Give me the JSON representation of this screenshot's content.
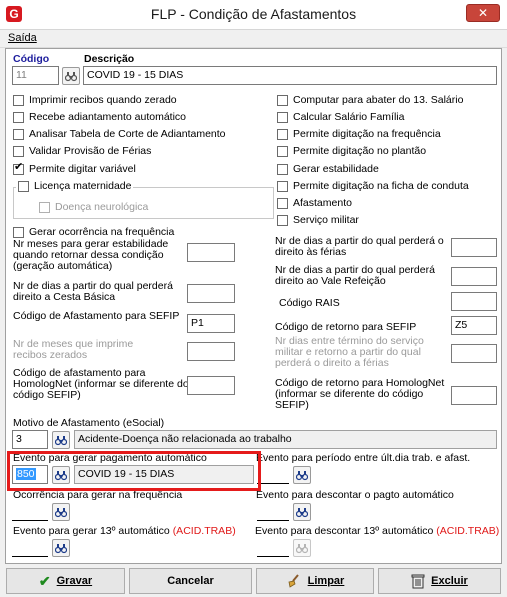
{
  "window": {
    "title": "FLP - Condição de Afastamentos",
    "close_glyph": "✕",
    "app_icon_glyph": "G"
  },
  "menu": {
    "items": [
      "Saída"
    ]
  },
  "header": {
    "codigo_label": "Código",
    "descricao_label": "Descrição",
    "codigo_value": "11",
    "descricao_value": "COVID 19 - 15 DIAS"
  },
  "left_checks": [
    {
      "label": "Imprimir recibos quando zerado",
      "checked": false
    },
    {
      "label": "Recebe adiantamento automático",
      "checked": false
    },
    {
      "label": "Analisar Tabela de Corte de Adiantamento",
      "checked": false
    },
    {
      "label": "Validar Provisão de Férias",
      "checked": false
    },
    {
      "label": "Permite digitar variável",
      "checked": true
    }
  ],
  "licenca": {
    "label": "Licença maternidade",
    "sub_label": "Doença neurológica"
  },
  "right_checks": [
    {
      "label": "Computar para abater do 13. Salário",
      "checked": false
    },
    {
      "label": "Calcular Salário Família",
      "checked": false
    },
    {
      "label": "Permite digitação na frequência",
      "checked": false
    },
    {
      "label": "Permite digitação no plantão",
      "checked": false
    },
    {
      "label": "Gerar estabilidade",
      "checked": false
    },
    {
      "label": "Permite digitação na ficha de conduta",
      "checked": false
    },
    {
      "label": "Afastamento",
      "checked": false
    },
    {
      "label": "Serviço militar",
      "checked": false
    }
  ],
  "gerar_ocorrencia": "Gerar ocorrência na frequência",
  "fields_left": {
    "nr_meses_estab": "Nr meses para gerar estabilidade quando retornar dessa condição (geração automática)",
    "nr_dias_cesta": "Nr de dias a partir do qual perderá direito a Cesta Básica",
    "cod_afast_sefip": "Código de Afastamento para SEFIP",
    "cod_afast_sefip_value": "P1",
    "nr_meses_recibos": "Nr de meses que imprime recibos zerados",
    "cod_homolognet": "Código de afastamento para HomologNet (informar se diferente do código SEFIP)"
  },
  "fields_right": {
    "nr_dias_ferias": "Nr de dias a partir do qual perderá o direito às férias",
    "nr_dias_vale": "Nr de dias a partir do qual perderá direito ao Vale Refeição",
    "codigo_rais": "Código RAIS",
    "cod_retorno_sefip": "Código de retorno para SEFIP",
    "cod_retorno_sefip_value": "Z5",
    "nr_dias_termino": "Nr dias entre término do serviço militar e retorno a partir do qual perderá o direito a férias",
    "cod_retorno_homolognet": "Código de retorno para HomologNet (informar se diferente do código SEFIP)"
  },
  "motivo": {
    "label": "Motivo de Afastamento (eSocial)",
    "code": "3",
    "desc": "Acidente-Doença não relacionada ao trabalho"
  },
  "eventos": {
    "pagamento_label": "Evento para gerar pagamento automático",
    "pagamento_code": "850",
    "pagamento_desc": "COVID 19 - 15 DIAS",
    "periodo_label": "Evento para período entre últ.dia trab. e afast.",
    "ocorrencia_label": "Ocorrência para gerar na frequência",
    "descontar_label": "Evento para descontar o pagto automático",
    "gerar13_label": "Evento para gerar 13º automático",
    "gerar13_tag": "(ACID.TRAB)",
    "descontar13_label": "Evento para descontar 13º automático",
    "descontar13_tag": "(ACID.TRAB)"
  },
  "buttons": {
    "gravar": "Gravar",
    "cancelar": "Cancelar",
    "limpar": "Limpar",
    "excluir": "Excluir"
  },
  "colors": {
    "highlight": "#e51b1b",
    "accent_blue": "#1c1c9c",
    "tag_red": "#e01818"
  },
  "icons": [
    "search-icon",
    "checkmark-icon",
    "broom-icon",
    "trash-icon",
    "close-icon"
  ]
}
